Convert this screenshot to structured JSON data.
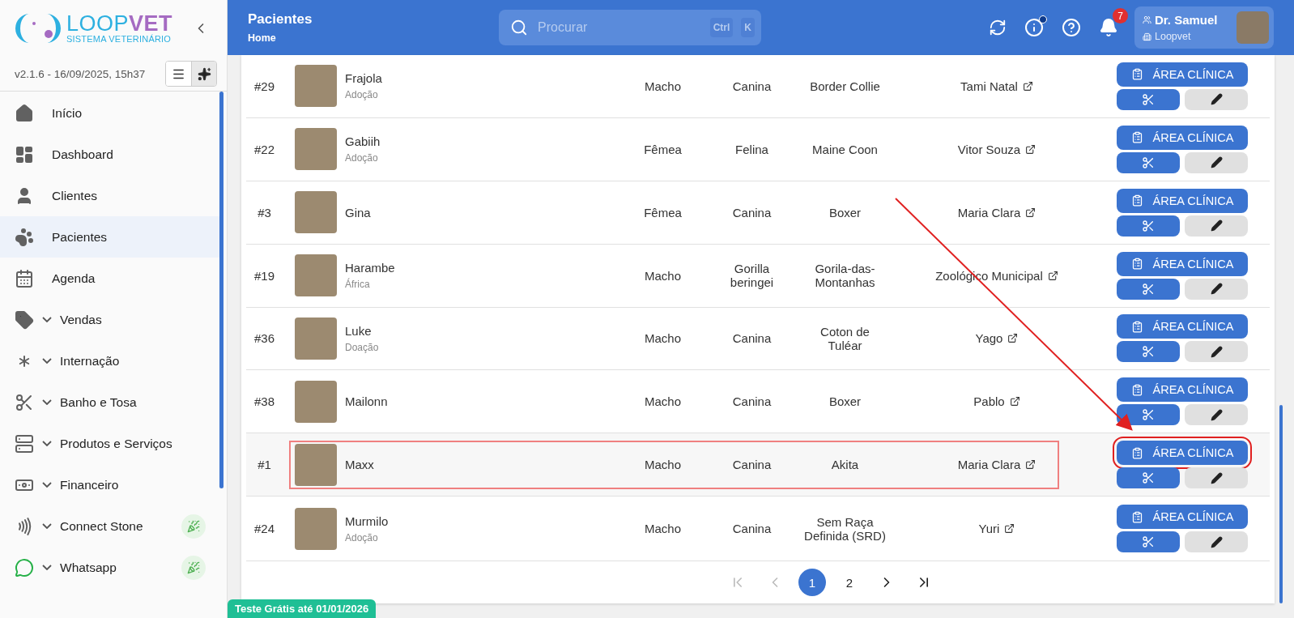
{
  "sidebar": {
    "logo": {
      "primary": "LOOP",
      "secondary": "VET",
      "tagline": "SISTEMA VETERINÁRIO"
    },
    "version": "v2.1.6 - 16/09/2025, 15h37",
    "items": [
      {
        "label": "Início",
        "expandable": false,
        "selected": false,
        "new": false
      },
      {
        "label": "Dashboard",
        "expandable": false,
        "selected": false,
        "new": false
      },
      {
        "label": "Clientes",
        "expandable": false,
        "selected": false,
        "new": false
      },
      {
        "label": "Pacientes",
        "expandable": false,
        "selected": true,
        "new": false
      },
      {
        "label": "Agenda",
        "expandable": false,
        "selected": false,
        "new": false
      },
      {
        "label": "Vendas",
        "expandable": true,
        "selected": false,
        "new": false
      },
      {
        "label": "Internação",
        "expandable": true,
        "selected": false,
        "new": false
      },
      {
        "label": "Banho e Tosa",
        "expandable": true,
        "selected": false,
        "new": false
      },
      {
        "label": "Produtos e Serviços",
        "expandable": true,
        "selected": false,
        "new": false
      },
      {
        "label": "Financeiro",
        "expandable": true,
        "selected": false,
        "new": false
      },
      {
        "label": "Connect Stone",
        "expandable": true,
        "selected": false,
        "new": true
      },
      {
        "label": "Whatsapp",
        "expandable": true,
        "selected": false,
        "new": true
      }
    ]
  },
  "header": {
    "title": "Pacientes",
    "breadcrumb": "Home",
    "search": {
      "placeholder": "Procurar",
      "keys": [
        "Ctrl",
        "K"
      ]
    },
    "info_dot": true,
    "notifications": "7",
    "user": {
      "name": "Dr. Samuel",
      "organization": "Loopvet"
    }
  },
  "table": {
    "rows": [
      {
        "id": "#29",
        "name": "Frajola",
        "note": "Adoção",
        "sex": "Macho",
        "species": "Canina",
        "breed": "Border Collie",
        "tutor": "Tami Natal",
        "action": "ÁREA CLÍNICA",
        "highlighted": false
      },
      {
        "id": "#22",
        "name": "Gabiih",
        "note": "Adoção",
        "sex": "Fêmea",
        "species": "Felina",
        "breed": "Maine Coon",
        "tutor": "Vitor Souza",
        "action": "ÁREA CLÍNICA",
        "highlighted": false
      },
      {
        "id": "#3",
        "name": "Gina",
        "sex": "Fêmea",
        "species": "Canina",
        "breed": "Boxer",
        "tutor": "Maria Clara",
        "action": "ÁREA CLÍNICA",
        "highlighted": false
      },
      {
        "id": "#19",
        "name": "Harambe",
        "note": "África",
        "sex": "Macho",
        "species": "Gorilla beringei",
        "breed": "Gorila-das-Montanhas",
        "tutor": "Zoológico Municipal",
        "action": "ÁREA CLÍNICA",
        "highlighted": false
      },
      {
        "id": "#36",
        "name": "Luke",
        "note": "Doação",
        "sex": "Macho",
        "species": "Canina",
        "breed": "Coton de Tuléar",
        "tutor": "Yago",
        "action": "ÁREA CLÍNICA",
        "highlighted": false
      },
      {
        "id": "#38",
        "name": "Mailonn",
        "sex": "Macho",
        "species": "Canina",
        "breed": "Boxer",
        "tutor": "Pablo",
        "action": "ÁREA CLÍNICA",
        "highlighted": false
      },
      {
        "id": "#1",
        "name": "Maxx",
        "sex": "Macho",
        "species": "Canina",
        "breed": "Akita",
        "tutor": "Maria Clara",
        "action": "ÁREA CLÍNICA",
        "highlighted": true
      },
      {
        "id": "#24",
        "name": "Murmilo",
        "note": "Adoção",
        "sex": "Macho",
        "species": "Canina",
        "breed": "Sem Raça Definida (SRD)",
        "tutor": "Yuri",
        "action": "ÁREA CLÍNICA",
        "highlighted": false
      }
    ]
  },
  "pagination": [
    {
      "kind": "first",
      "disabled": true
    },
    {
      "kind": "prev",
      "disabled": true
    },
    {
      "kind": "page",
      "label": "1",
      "selected": true
    },
    {
      "kind": "page",
      "label": "2",
      "selected": false
    },
    {
      "kind": "next",
      "disabled": false
    },
    {
      "kind": "last",
      "disabled": false
    }
  ],
  "trial_badge": "Teste Grátis até 01/01/2026"
}
